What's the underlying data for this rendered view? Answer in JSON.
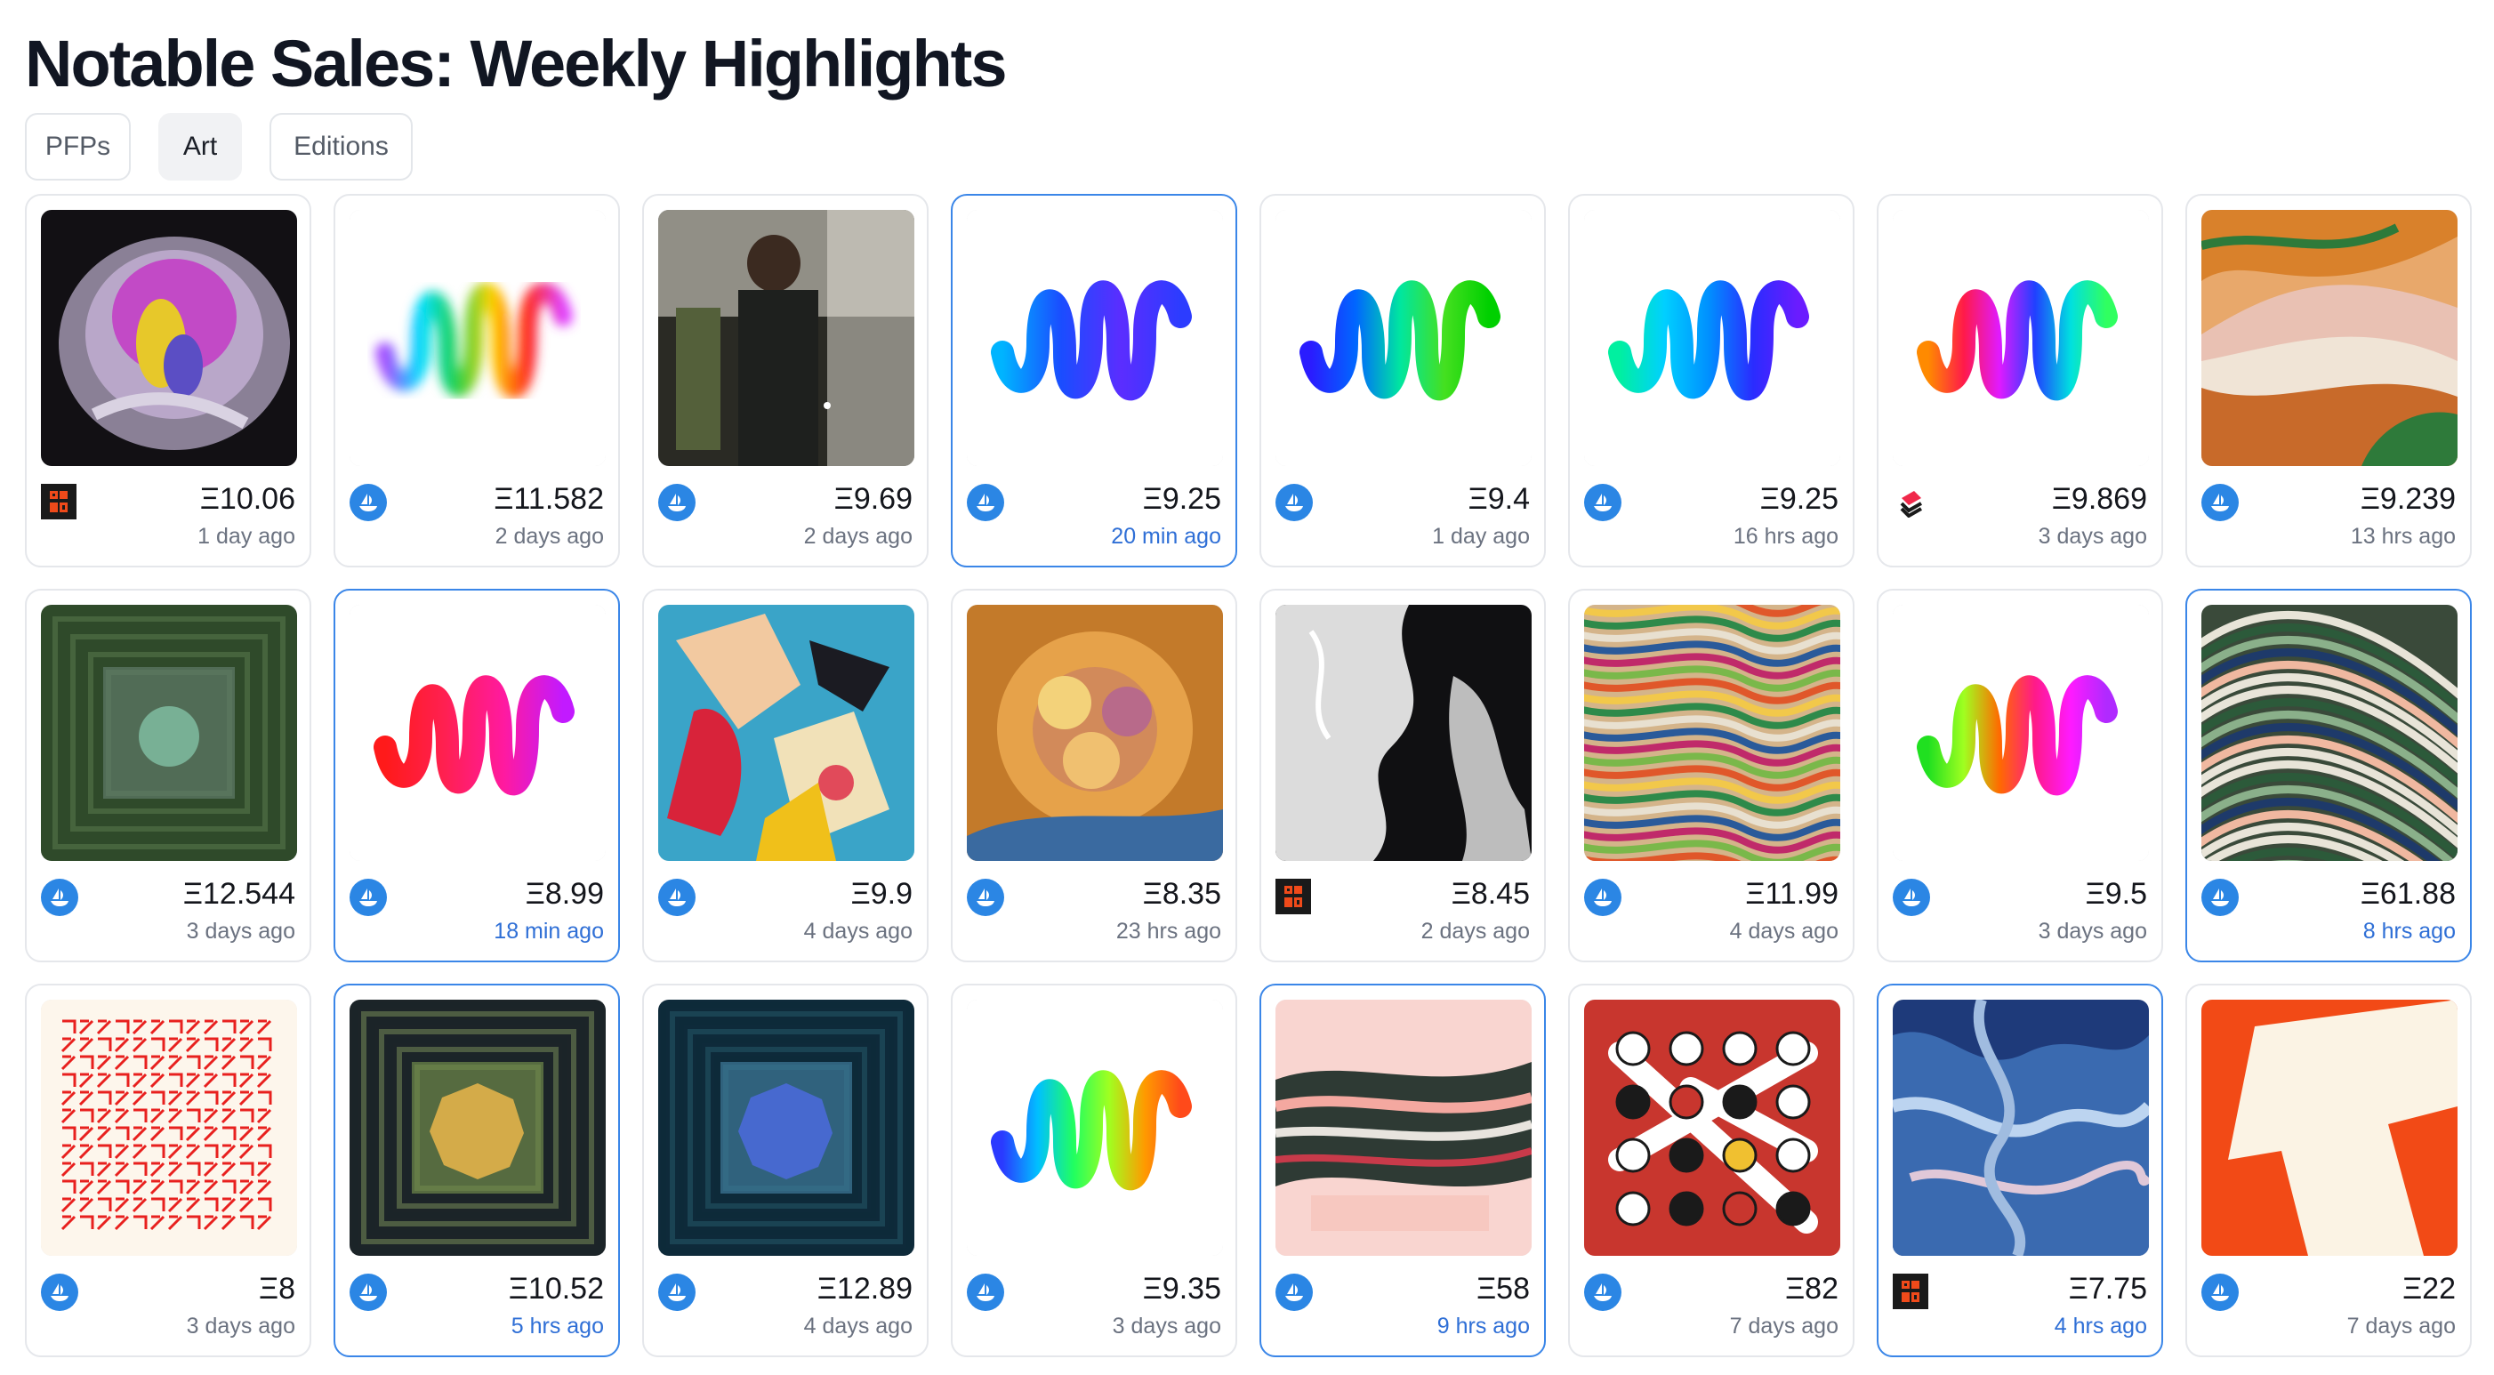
{
  "page": {
    "title": "Notable Sales: Weekly Highlights"
  },
  "tabs": [
    {
      "label": "PFPs",
      "active": false
    },
    {
      "label": "Art",
      "active": true
    },
    {
      "label": "Editions",
      "active": false
    }
  ],
  "colors": {
    "accent": "#3a86e8",
    "opensea": "#2b86e4",
    "muted_text": "#6b7280",
    "recent_text": "#2f6fd6"
  },
  "cards": [
    {
      "price": "Ξ10.06",
      "time": "1 day ago",
      "market": "superrare-icon",
      "recent": false,
      "art": "purple-flower-sculpture"
    },
    {
      "price": "Ξ11.582",
      "time": "2 days ago",
      "market": "opensea-icon",
      "recent": false,
      "art": "blurred-rainbow-squiggle"
    },
    {
      "price": "Ξ9.69",
      "time": "2 days ago",
      "market": "opensea-icon",
      "recent": false,
      "art": "dark-figure-photo"
    },
    {
      "price": "Ξ9.25",
      "time": "20 min ago",
      "market": "opensea-icon",
      "recent": true,
      "art": "blue-squiggle"
    },
    {
      "price": "Ξ9.4",
      "time": "1 day ago",
      "market": "opensea-icon",
      "recent": false,
      "art": "blue-green-squiggle"
    },
    {
      "price": "Ξ9.25",
      "time": "16 hrs ago",
      "market": "opensea-icon",
      "recent": false,
      "art": "cyan-blue-squiggle"
    },
    {
      "price": "Ξ9.869",
      "time": "3 days ago",
      "market": "foundation-icon",
      "recent": false,
      "art": "rainbow-squiggle"
    },
    {
      "price": "Ξ9.239",
      "time": "13 hrs ago",
      "market": "opensea-icon",
      "recent": false,
      "art": "orange-landscape"
    },
    {
      "price": "Ξ12.544",
      "time": "3 days ago",
      "market": "opensea-icon",
      "recent": false,
      "art": "green-square-orb"
    },
    {
      "price": "Ξ8.99",
      "time": "18 min ago",
      "market": "opensea-icon",
      "recent": true,
      "art": "red-magenta-squiggle"
    },
    {
      "price": "Ξ9.9",
      "time": "4 days ago",
      "market": "opensea-icon",
      "recent": false,
      "art": "abstract-collage"
    },
    {
      "price": "Ξ8.35",
      "time": "23 hrs ago",
      "market": "opensea-icon",
      "recent": false,
      "art": "golden-flower"
    },
    {
      "price": "Ξ8.45",
      "time": "2 days ago",
      "market": "superrare-icon",
      "recent": false,
      "art": "black-white-fluid"
    },
    {
      "price": "Ξ11.99",
      "time": "4 days ago",
      "market": "opensea-icon",
      "recent": false,
      "art": "striped-strata"
    },
    {
      "price": "Ξ9.5",
      "time": "3 days ago",
      "market": "opensea-icon",
      "recent": false,
      "art": "green-pink-squiggle"
    },
    {
      "price": "Ξ61.88",
      "time": "8 hrs ago",
      "market": "opensea-icon",
      "recent": true,
      "art": "curved-stripes"
    },
    {
      "price": "Ξ8",
      "time": "3 days ago",
      "market": "opensea-icon",
      "recent": false,
      "art": "red-glyph-grid"
    },
    {
      "price": "Ξ10.52",
      "time": "5 hrs ago",
      "market": "opensea-icon",
      "recent": true,
      "art": "yellow-polygon-square"
    },
    {
      "price": "Ξ12.89",
      "time": "4 days ago",
      "market": "opensea-icon",
      "recent": false,
      "art": "blue-polygon-square"
    },
    {
      "price": "Ξ9.35",
      "time": "3 days ago",
      "market": "opensea-icon",
      "recent": false,
      "art": "rainbow-squiggle-small"
    },
    {
      "price": "Ξ58",
      "time": "9 hrs ago",
      "market": "opensea-icon",
      "recent": true,
      "art": "pink-stripes"
    },
    {
      "price": "Ξ82",
      "time": "7 days ago",
      "market": "opensea-icon",
      "recent": false,
      "art": "dot-grid"
    },
    {
      "price": "Ξ7.75",
      "time": "4 hrs ago",
      "market": "superrare-icon",
      "recent": true,
      "art": "blue-marble-texture"
    },
    {
      "price": "Ξ22",
      "time": "7 days ago",
      "market": "opensea-icon",
      "recent": false,
      "art": "orange-white-t"
    }
  ]
}
